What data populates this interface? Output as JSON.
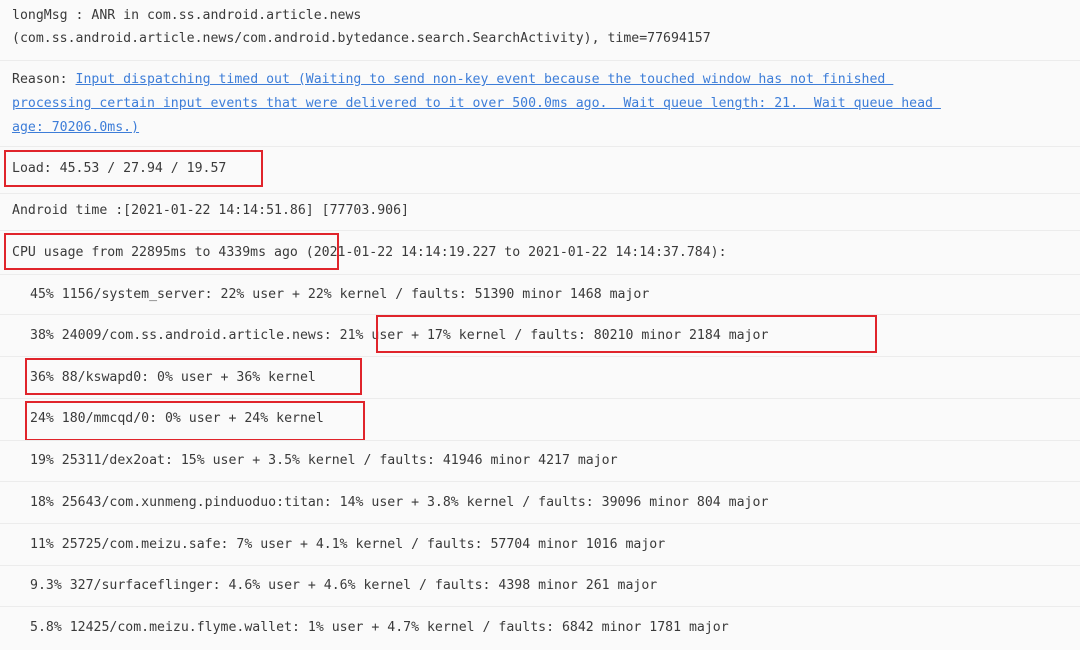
{
  "header": {
    "line1": "longMsg : ANR in com.ss.android.article.news",
    "line2": "(com.ss.android.article.news/com.android.bytedance.search.SearchActivity), time=77694157"
  },
  "reason": {
    "label": "Reason: ",
    "text_l1": "Input dispatching timed out (Waiting to send non-key event because the touched window has not finished ",
    "text_l2": "processing certain input events that were delivered to it over 500.0ms ago.  Wait queue length: 21.  Wait queue head ",
    "text_l3": "age: 70206.0ms.)"
  },
  "load": "Load: 45.53 / 27.94 / 19.57",
  "android_time": "Android time :[2021-01-22 14:14:51.86] [77703.906]",
  "cpu_usage": {
    "prefix": "CPU usage from 22895ms to 4339ms ago",
    "suffix": " (2021-01-22 14:14:19.227 to 2021-01-22 14:14:37.784):"
  },
  "processes": [
    {
      "text": "45% 1156/system_server: 22% user + 22% kernel / faults: 51390 minor 1468 major"
    },
    {
      "prefix": "38% 24009/com.ss.android.article.news: ",
      "text": "21% user + 17% kernel / faults: 80210 minor 2184 major"
    },
    {
      "text": "36% 88/kswapd0: 0% user + 36% kernel"
    },
    {
      "text": "24% 180/mmcqd/0: 0% user + 24% kernel"
    },
    {
      "text": "19% 25311/dex2oat: 15% user + 3.5% kernel / faults: 41946 minor 4217 major"
    },
    {
      "text": "18% 25643/com.xunmeng.pinduoduo:titan: 14% user + 3.8% kernel / faults: 39096 minor 804 major"
    },
    {
      "text": "11% 25725/com.meizu.safe: 7% user + 4.1% kernel / faults: 57704 minor 1016 major"
    },
    {
      "text": "9.3% 327/surfaceflinger: 4.6% user + 4.6% kernel / faults: 4398 minor 261 major"
    },
    {
      "text": "5.8% 12425/com.meizu.flyme.wallet: 1% user + 4.7% kernel / faults: 6842 minor 1781 major"
    }
  ],
  "colors": {
    "highlight_box": "#e0242b",
    "link": "#3d7dd8",
    "text": "#3a3a3a",
    "background": "#fafafa"
  }
}
